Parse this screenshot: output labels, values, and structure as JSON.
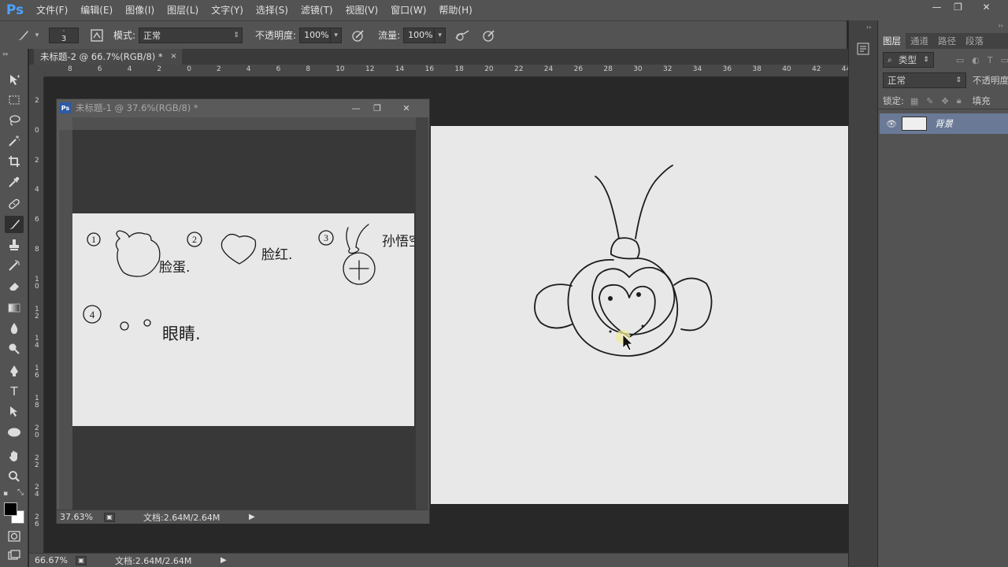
{
  "app": {
    "logo": "Ps"
  },
  "menu": [
    "文件(F)",
    "编辑(E)",
    "图像(I)",
    "图层(L)",
    "文字(Y)",
    "选择(S)",
    "滤镜(T)",
    "视图(V)",
    "窗口(W)",
    "帮助(H)"
  ],
  "window_controls": {
    "minimize": "—",
    "restore": "❐",
    "close": "✕"
  },
  "options": {
    "brush_size": "3",
    "mode_label": "模式:",
    "mode_value": "正常",
    "opacity_label": "不透明度:",
    "opacity_value": "100%",
    "flow_label": "流量:",
    "flow_value": "100%"
  },
  "tab": {
    "title": "未标题-2 @ 66.7%(RGB/8) *",
    "close": "×"
  },
  "ruler": {
    "h": [
      "8",
      "6",
      "4",
      "2",
      "0",
      "2",
      "4",
      "6",
      "8",
      "10",
      "12",
      "14",
      "16",
      "18",
      "20",
      "22",
      "24",
      "26",
      "28",
      "30",
      "32",
      "34",
      "36",
      "38",
      "40",
      "42",
      "44"
    ],
    "v": [
      "2",
      "0",
      "2",
      "4",
      "6",
      "8",
      "1\n0",
      "1\n2",
      "1\n4",
      "1\n6",
      "1\n8",
      "2\n0",
      "2\n2",
      "2\n4",
      "2\n6"
    ]
  },
  "float_window": {
    "title": "未标题-1 @ 37.6%(RGB/8) *",
    "zoom": "37.63%",
    "doc_info": "文档:2.64M/2.64M",
    "sketch_labels": {
      "n1": "1",
      "n2": "2",
      "n3": "3",
      "n4": "4",
      "t1": "脸蛋.",
      "t2": "脸红.",
      "t3": "孙悟空",
      "t4": "眼睛."
    }
  },
  "status": {
    "zoom": "66.67%",
    "doc_info": "文档:2.64M/2.64M"
  },
  "layers_panel": {
    "tabs": [
      "图层",
      "通道",
      "路径",
      "段落"
    ],
    "active_tab": 0,
    "filter_kind": "类型",
    "blend_mode": "正常",
    "opacity_label": "不透明度",
    "lock_label": "锁定:",
    "fill_label": "填充",
    "layers": [
      {
        "name": "背景",
        "visible": true
      }
    ]
  },
  "colors": {
    "accent": "#4aa3ff",
    "selected_layer": "#6a7a96",
    "canvas": "#e8e8e8"
  }
}
